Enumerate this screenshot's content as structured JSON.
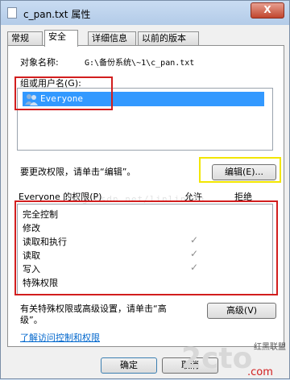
{
  "window": {
    "title": "c_pan.txt 属性",
    "close_label": "X"
  },
  "tabs": [
    {
      "label": "常规"
    },
    {
      "label": "安全",
      "active": true
    },
    {
      "label": "详细信息"
    },
    {
      "label": "以前的版本"
    }
  ],
  "security": {
    "object_label": "对象名称:",
    "object_value": "G:\\备份系统\\~1\\c_pan.txt",
    "group_label": "组或用户名(G):",
    "users": [
      {
        "name": "Everyone",
        "icon": "users-icon"
      }
    ],
    "change_hint": "要更改权限，请单击“编辑”。",
    "edit_button": "编辑(E)...",
    "perm_title": "Everyone 的权限(P)",
    "allow_header": "允许",
    "deny_header": "拒绝",
    "permissions": [
      {
        "name": "完全控制",
        "allow": false,
        "deny": false
      },
      {
        "name": "修改",
        "allow": false,
        "deny": false
      },
      {
        "name": "读取和执行",
        "allow": true,
        "deny": false
      },
      {
        "name": "读取",
        "allow": true,
        "deny": false
      },
      {
        "name": "写入",
        "allow": true,
        "deny": false
      },
      {
        "name": "特殊权限",
        "allow": false,
        "deny": false
      }
    ],
    "advanced_hint_1": "有关特殊权限或高级设置，请单击“高",
    "advanced_hint_2": "级”。",
    "advanced_button": "高级(V)",
    "learn_link": "了解访问控制和权限"
  },
  "footer": {
    "ok_button": "确定",
    "cancel_button": "取消"
  },
  "watermark": "blog.csdn.net/linlinlin",
  "logo": {
    "main": "2cto",
    "sub": ".com",
    "side": "红黑联盟"
  },
  "colors": {
    "annotation_red": "#d21e1e",
    "annotation_yellow": "#f2e600",
    "selection": "#3399ff"
  }
}
